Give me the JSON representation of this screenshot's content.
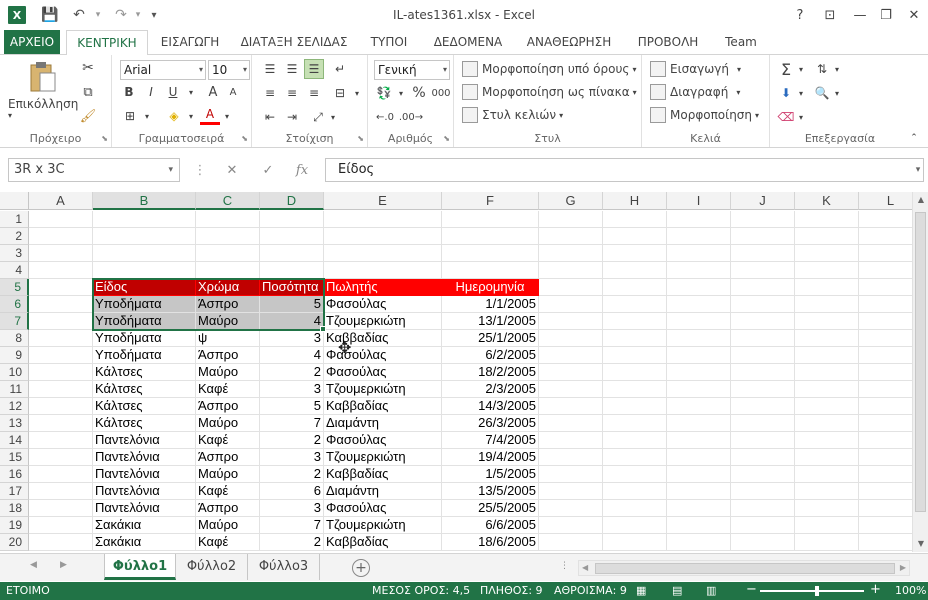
{
  "window": {
    "title": "IL-ates1361.xlsx - Excel",
    "help": "?",
    "minimize": "—",
    "restore": "❐",
    "close": "✕",
    "ribbon_display": "⊡"
  },
  "qat": {
    "save": "💾",
    "undo": "↶",
    "redo": "↷",
    "customize": "▾",
    "app_icon": "X"
  },
  "tabs": [
    "ΑΡΧΕΙΟ",
    "ΚΕΝΤΡΙΚΗ",
    "ΕΙΣΑΓΩΓΗ",
    "ΔΙΑΤΑΞΗ ΣΕΛΙΔΑΣ",
    "ΤΥΠΟΙ",
    "ΔΕΔΟΜΕΝΑ",
    "ΑΝΑΘΕΩΡΗΣΗ",
    "ΠΡΟΒΟΛΗ",
    "Team"
  ],
  "ribbon": {
    "clipboard": {
      "label": "Πρόχειρο",
      "paste": "Επικόλληση"
    },
    "font": {
      "label": "Γραμματοσειρά",
      "name": "Arial",
      "size": "10",
      "bold": "B",
      "italic": "I",
      "underline": "U",
      "grow": "A",
      "shrink": "A",
      "font_color": "A"
    },
    "alignment": {
      "label": "Στοίχιση"
    },
    "number": {
      "label": "Αριθμός",
      "format": "Γενική",
      "percent": "%",
      "comma": "000"
    },
    "styles": {
      "label": "Στυλ",
      "conditional": "Μορφοποίηση υπό όρους",
      "as_table": "Μορφοποίηση ως πίνακα",
      "cell_styles": "Στυλ κελιών"
    },
    "cells": {
      "label": "Κελιά",
      "insert": "Εισαγωγή",
      "delete": "Διαγραφή",
      "format": "Μορφοποίηση"
    },
    "editing": {
      "label": "Επεξεργασία",
      "sum": "Σ"
    }
  },
  "formula_bar": {
    "name_box": "3R x 3C",
    "cancel": "✕",
    "enter": "✓",
    "fx": "fx",
    "content": "Είδος"
  },
  "columns": [
    "A",
    "B",
    "C",
    "D",
    "E",
    "F",
    "G",
    "H",
    "I",
    "J",
    "K",
    "L"
  ],
  "rows": [
    "1",
    "2",
    "3",
    "4",
    "5",
    "6",
    "7",
    "8",
    "9",
    "10",
    "11",
    "12",
    "13",
    "14",
    "15",
    "16",
    "17",
    "18",
    "19",
    "20"
  ],
  "table": {
    "header": [
      "Είδος",
      "Χρώμα",
      "Ποσότητα",
      "Πωλητής",
      "Ημερομηνία"
    ],
    "data": [
      [
        "Υποδήματα",
        "Άσπρο",
        "5",
        "Φασούλας",
        "1/1/2005"
      ],
      [
        "Υποδήματα",
        "Μαύρο",
        "4",
        "Τζουμερκιώτη",
        "13/1/2005"
      ],
      [
        "Υποδήματα",
        "ψ",
        "3",
        "Καββαδίας",
        "25/1/2005"
      ],
      [
        "Υποδήματα",
        "Άσπρο",
        "4",
        "Φασούλας",
        "6/2/2005"
      ],
      [
        "Κάλτσες",
        "Μαύρο",
        "2",
        "Φασούλας",
        "18/2/2005"
      ],
      [
        "Κάλτσες",
        "Καφέ",
        "3",
        "Τζουμερκιώτη",
        "2/3/2005"
      ],
      [
        "Κάλτσες",
        "Άσπρο",
        "5",
        "Καββαδίας",
        "14/3/2005"
      ],
      [
        "Κάλτσες",
        "Μαύρο",
        "7",
        "Διαμάντη",
        "26/3/2005"
      ],
      [
        "Παντελόνια",
        "Καφέ",
        "2",
        "Φασούλας",
        "7/4/2005"
      ],
      [
        "Παντελόνια",
        "Άσπρο",
        "3",
        "Τζουμερκιώτη",
        "19/4/2005"
      ],
      [
        "Παντελόνια",
        "Μαύρο",
        "2",
        "Καββαδίας",
        "1/5/2005"
      ],
      [
        "Παντελόνια",
        "Καφέ",
        "6",
        "Διαμάντη",
        "13/5/2005"
      ],
      [
        "Παντελόνια",
        "Άσπρο",
        "3",
        "Φασούλας",
        "25/5/2005"
      ],
      [
        "Σακάκια",
        "Μαύρο",
        "7",
        "Τζουμερκιώτη",
        "6/6/2005"
      ],
      [
        "Σακάκια",
        "Καφέ",
        "2",
        "Καββαδίας",
        "18/6/2005"
      ]
    ]
  },
  "sheets": [
    "Φύλλο1",
    "Φύλλο2",
    "Φύλλο3"
  ],
  "add_sheet": "+",
  "status": {
    "ready": "ΕΤΟΙΜΟ",
    "average": "ΜΕΣΟΣ ΟΡΟΣ: 4,5",
    "count": "ΠΛΗΘΟΣ: 9",
    "sum": "ΑΘΡΟΙΣΜΑ: 9",
    "zoom": "100%",
    "zoom_minus": "−",
    "zoom_plus": "+"
  },
  "colors": {
    "excel_green": "#217346",
    "header_red": "#ff0000",
    "selection_gray": "#c6c6c6"
  }
}
